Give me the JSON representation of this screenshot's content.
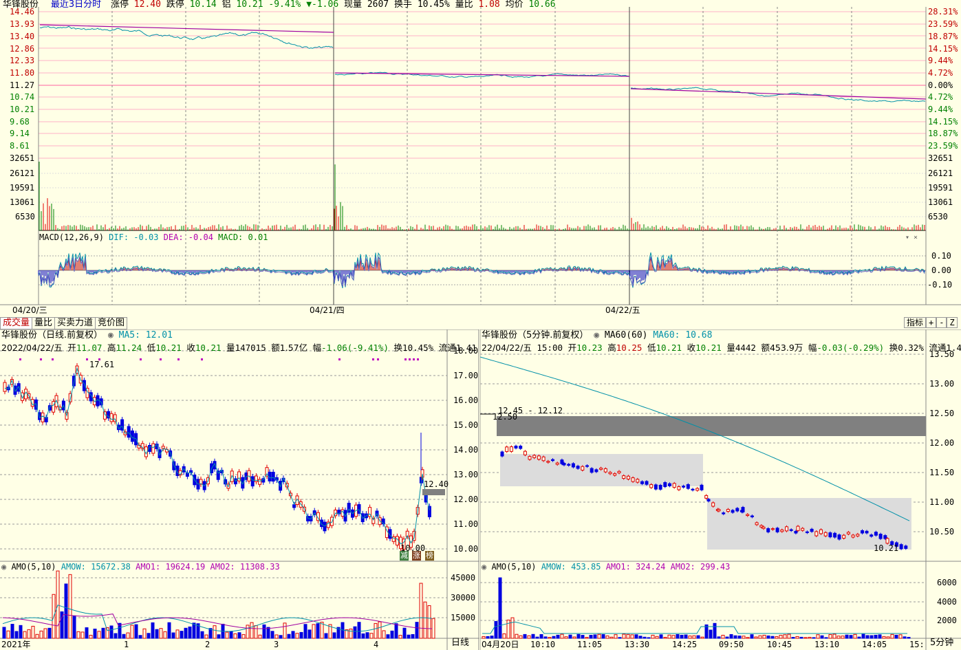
{
  "top_header": {
    "stock_name": "华锋股份",
    "period_link": "最近3日分时",
    "limit_up_label": "涨停",
    "limit_up": "12.40",
    "limit_down_label": "跌停",
    "limit_down": "10.14",
    "last_label": "铝",
    "last": "10.21",
    "pct": "-9.41%",
    "change": "▼-1.06",
    "volume_label": "现量",
    "volume": "2607",
    "turnover_label": "换手",
    "turnover": "10.45%",
    "ratio_label": "量比",
    "ratio": "1.08",
    "avg_label": "均价",
    "avg": "10.66"
  },
  "top_price_axis_left": [
    "14.46",
    "13.93",
    "13.40",
    "12.86",
    "12.33",
    "11.80",
    "11.27",
    "10.74",
    "10.21",
    "9.68",
    "9.14",
    "8.61"
  ],
  "top_price_axis_right": [
    "28.31%",
    "23.59%",
    "18.87%",
    "14.15%",
    "9.44%",
    "4.72%",
    "0.00%",
    "4.72%",
    "9.44%",
    "14.15%",
    "18.87%",
    "23.59%"
  ],
  "top_vol_axis": [
    "32651",
    "26121",
    "19591",
    "13061",
    "6530"
  ],
  "macd": {
    "label": "MACD(12,26,9)",
    "dif_label": "DIF:",
    "dif": "-0.03",
    "dea_label": "DEA:",
    "dea": "-0.04",
    "macd_label": "MACD:",
    "macd": "0.01",
    "axis": [
      "0.10",
      "0.00",
      "-0.10"
    ]
  },
  "top_dates": [
    "04/20/三",
    "04/21/四",
    "04/22/五"
  ],
  "tabs": [
    "成交量",
    "量比",
    "买卖力道",
    "竞价图"
  ],
  "right_buttons": [
    "指标",
    "+",
    "-",
    "Z"
  ],
  "daily": {
    "title": "华锋股份（日线.前复权）",
    "ma_label": "MA5:",
    "ma": "12.01",
    "info_date": "2022/04/22/五",
    "open_label": "开",
    "open": "11.07",
    "high_label": "高",
    "high": "11.24",
    "low_label": "低",
    "low": "10.21",
    "close_label": "收",
    "close": "10.21",
    "vol_label": "量",
    "vol": "147015",
    "amt_label": "额",
    "amt": "1.57亿",
    "range_label": "幅",
    "range": "-1.06(-9.41%)",
    "turn_label": "换",
    "turn": "10.45%",
    "float_label": "流通",
    "float": "1.41",
    "axis": [
      "18.00",
      "17.00",
      "16.00",
      "15.00",
      "14.00",
      "13.00",
      "12.00",
      "11.00",
      "10.00"
    ],
    "high_mark": "17.61",
    "low_mark": "10.00",
    "price_tag": "12.40",
    "badges": [
      "减",
      "涨",
      "榜"
    ],
    "amo_label": "AMO(5,10)",
    "amow_label": "AMOW:",
    "amow": "15672.38",
    "amo1_label": "AMO1:",
    "amo1": "19624.19",
    "amo2_label": "AMO2:",
    "amo2": "11308.33",
    "amo_axis": [
      "45000",
      "30000",
      "15000"
    ],
    "x_labels": [
      "2021年",
      "1",
      "2",
      "3",
      "4"
    ],
    "period_button": "日线"
  },
  "min5": {
    "title": "华锋股份（5分钟.前复权）",
    "ma_label": "MA60(60)",
    "ma_name": "MA60:",
    "ma": "10.68",
    "info_date": "22/04/22/五",
    "time": "15:00",
    "open_label": "开",
    "open": "10.23",
    "high_label": "高",
    "high": "10.25",
    "low_label": "低",
    "low": "10.21",
    "close_label": "收",
    "close": "10.21",
    "vol_label": "量",
    "vol": "4442",
    "amt_label": "额",
    "amt": "453.9万",
    "range_label": "幅",
    "range": "-0.03(-0.29%)",
    "turn_label": "换",
    "turn": "0.32%",
    "float_label": "流通",
    "float": "1.4",
    "axis": [
      "13.50",
      "13.00",
      "12.50",
      "12.00",
      "11.50",
      "11.00",
      "10.50"
    ],
    "gap_label": "12.45 - 12.12",
    "start_mark": "12.50",
    "end_mark": "10.21",
    "amo_label": "AMO(5,10)",
    "amow_label": "AMOW:",
    "amow": "453.85",
    "amo1_label": "AMO1:",
    "amo1": "324.24",
    "amo2_label": "AMO2:",
    "amo2": "299.43",
    "amo_axis": [
      "6000",
      "4000",
      "2000"
    ],
    "x_labels": [
      "04月20日",
      "10:10",
      "11:05",
      "13:30",
      "14:25",
      "09:50",
      "10:45",
      "13:10",
      "14:05",
      "15:"
    ],
    "period_button": "5分钟"
  },
  "colors": {
    "bg": "#FFFFE6",
    "up": "#E00000",
    "down": "#0000E0",
    "price": "#0090A8",
    "avg": "#A000A0",
    "grid": "#FF80A0"
  }
}
